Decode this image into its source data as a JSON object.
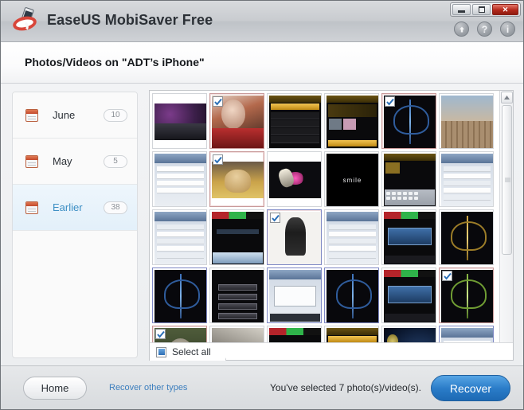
{
  "window": {
    "app_title": "EaseUS MobiSaver Free",
    "logo_icon": "lifebuoy-phone-logo",
    "controls": [
      {
        "name": "minimize-button",
        "label": "minimize-icon"
      },
      {
        "name": "maximize-button",
        "label": "maximize-icon"
      },
      {
        "name": "close-button",
        "label": "✕"
      }
    ],
    "toolbar_icons": [
      {
        "name": "update-icon",
        "glyph": "↑"
      },
      {
        "name": "help-icon",
        "glyph": "?"
      },
      {
        "name": "info-icon",
        "glyph": "i"
      }
    ]
  },
  "header": {
    "page_title": "Photos/Videos on \"ADT’s iPhone\""
  },
  "sidebar": {
    "items": [
      {
        "label": "June",
        "count": "10",
        "selected": false,
        "icon": "calendar-icon"
      },
      {
        "label": "May",
        "count": "5",
        "selected": false,
        "icon": "calendar-icon"
      },
      {
        "label": "Earlier",
        "count": "38",
        "selected": true,
        "icon": "calendar-icon"
      }
    ]
  },
  "grid": {
    "select_all_label": "Select all",
    "select_all_state": "indeterminate",
    "columns": 6,
    "thumbnails": [
      {
        "index": 1,
        "art": "photo1",
        "checked": false,
        "focused": false,
        "wide": true
      },
      {
        "index": 2,
        "art": "photoA",
        "checked": true,
        "focused": false,
        "wide": false
      },
      {
        "index": 3,
        "art": "gold-list",
        "checked": false,
        "focused": false,
        "wide": false
      },
      {
        "index": 4,
        "art": "gold-media",
        "checked": false,
        "focused": false,
        "wide": false
      },
      {
        "index": 5,
        "art": "orn-blue",
        "checked": true,
        "focused": false,
        "wide": false
      },
      {
        "index": 6,
        "art": "photoCity",
        "checked": false,
        "focused": false,
        "wide": false
      },
      {
        "index": 7,
        "art": "ios-list",
        "checked": false,
        "focused": false,
        "wide": false
      },
      {
        "index": 8,
        "art": "photoDog",
        "checked": true,
        "focused": false,
        "wide": true
      },
      {
        "index": 9,
        "art": "photoNeon",
        "checked": false,
        "focused": false,
        "wide": true
      },
      {
        "index": 10,
        "art": "photoSmile",
        "checked": false,
        "focused": false,
        "wide": false
      },
      {
        "index": 11,
        "art": "gold-kb",
        "checked": false,
        "focused": false,
        "wide": false
      },
      {
        "index": 12,
        "art": "ios-sett",
        "checked": false,
        "focused": false,
        "wide": false
      },
      {
        "index": 13,
        "art": "ios-sett",
        "checked": false,
        "focused": false,
        "wide": false
      },
      {
        "index": 14,
        "art": "rgb-dark",
        "checked": false,
        "focused": false,
        "wide": false
      },
      {
        "index": 15,
        "art": "photoBW",
        "checked": true,
        "focused": true,
        "wide": false
      },
      {
        "index": 16,
        "art": "ios-sett",
        "checked": false,
        "focused": false,
        "wide": false
      },
      {
        "index": 17,
        "art": "rgb-blue",
        "checked": false,
        "focused": false,
        "wide": false
      },
      {
        "index": 18,
        "art": "orn-gold",
        "checked": false,
        "focused": false,
        "wide": false
      },
      {
        "index": 19,
        "art": "orn-blue",
        "checked": false,
        "focused": true,
        "wide": false
      },
      {
        "index": 20,
        "art": "blk-menu",
        "checked": false,
        "focused": false,
        "wide": false
      },
      {
        "index": 21,
        "art": "ios-dlg",
        "checked": false,
        "focused": true,
        "wide": false
      },
      {
        "index": 22,
        "art": "orn-blue",
        "checked": false,
        "focused": true,
        "wide": false
      },
      {
        "index": 23,
        "art": "rgb-blue",
        "checked": false,
        "focused": false,
        "wide": false
      },
      {
        "index": 24,
        "art": "orn-green",
        "checked": true,
        "focused": false,
        "wide": false
      },
      {
        "index": 25,
        "art": "photoOwl",
        "checked": true,
        "focused": false,
        "wide": false
      },
      {
        "index": 26,
        "art": "photoRoof",
        "checked": false,
        "focused": false,
        "wide": false
      },
      {
        "index": 27,
        "art": "rgb-dark",
        "checked": false,
        "focused": false,
        "wide": false
      },
      {
        "index": 28,
        "art": "gold-list",
        "checked": false,
        "focused": false,
        "wide": false
      },
      {
        "index": 29,
        "art": "photoSpace",
        "checked": false,
        "focused": false,
        "wide": false
      },
      {
        "index": 30,
        "art": "ios-list",
        "checked": false,
        "focused": true,
        "wide": false
      }
    ],
    "scrollbar": {
      "up_arrow": "▲",
      "down_arrow": "▼"
    }
  },
  "footer": {
    "home_label": "Home",
    "other_types_label": "Recover other types",
    "status": "You've selected 7 photo(s)/video(s).",
    "recover_label": "Recover"
  },
  "colors": {
    "accent_blue": "#2a7cc8",
    "link_blue": "#3d7fbe",
    "selected_item_blue": "#3d8fc4",
    "close_red": "#b4281b"
  }
}
